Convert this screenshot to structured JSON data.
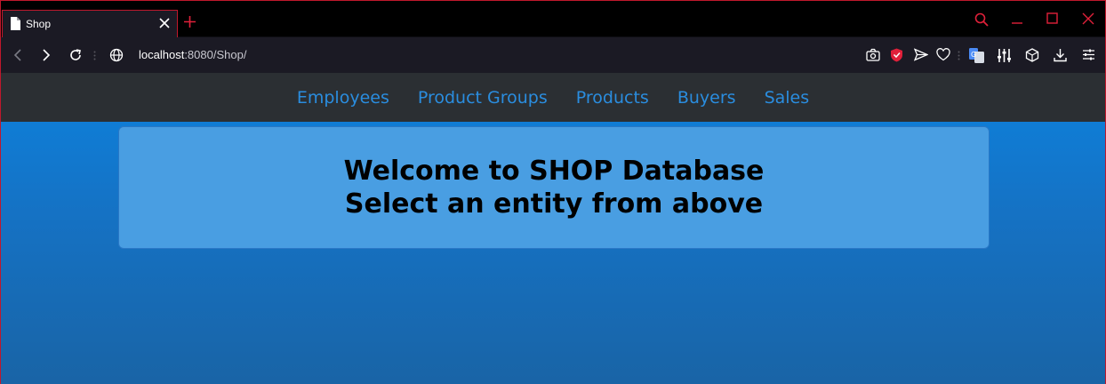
{
  "browser": {
    "tab": {
      "title": "Shop"
    },
    "url": {
      "host": "localhost",
      "path": ":8080/Shop/"
    },
    "accent_color": "#c0182c"
  },
  "nav": {
    "links": [
      "Employees",
      "Product Groups",
      "Products",
      "Buyers",
      "Sales"
    ],
    "link_color": "#2a8ddf",
    "background": "#2b2f33"
  },
  "welcome": {
    "line1": "Welcome to SHOP Database",
    "line2": "Select an entity from above"
  },
  "icons": {
    "tab": [
      "document-icon",
      "close-icon"
    ],
    "window": [
      "search-icon",
      "minimize-icon",
      "maximize-icon",
      "close-window-icon"
    ],
    "toolbar": [
      "camera-icon",
      "shield-icon",
      "send-icon",
      "heart-icon",
      "translate-icon",
      "equalizer-icon",
      "cube-icon",
      "download-icon",
      "menu-icon"
    ]
  }
}
